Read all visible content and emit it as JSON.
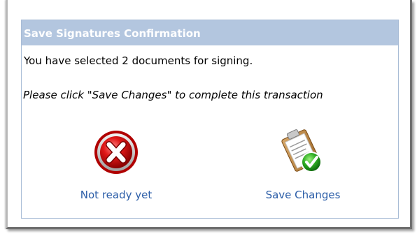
{
  "dialog": {
    "title": "Save Signatures Confirmation",
    "message": "You have selected 2 documents for signing.",
    "instruction": "Please click \"Save Changes\" to complete this transaction",
    "accent_header_color": "#b3c6df",
    "link_color": "#2c5ea8"
  },
  "actions": {
    "cancel": {
      "label": "Not ready yet",
      "icon": "red-x-icon"
    },
    "save": {
      "label": "Save Changes",
      "icon": "clipboard-check-icon"
    }
  }
}
